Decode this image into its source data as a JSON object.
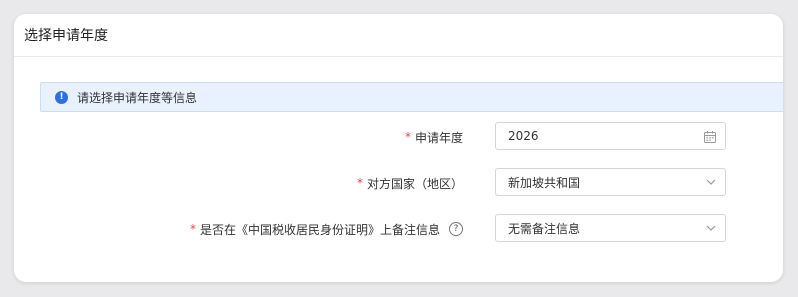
{
  "dialog": {
    "title": "选择申请年度"
  },
  "alert": {
    "icon": "info-icon",
    "text": "请选择申请年度等信息",
    "icon_color": "#2f6fde",
    "bg_color": "#e8f1fd"
  },
  "form": {
    "required_mark": "*",
    "fields": [
      {
        "label": "申请年度",
        "value": "2026",
        "type": "date",
        "icon": "calendar-icon"
      },
      {
        "label": "对方国家（地区）",
        "value": "新加坡共和国",
        "type": "select",
        "icon": "chevron-down-icon"
      },
      {
        "label": "是否在《中国税收居民身份证明》上备注信息",
        "value": "无需备注信息",
        "type": "select",
        "icon": "chevron-down-icon",
        "help_icon": "question-circle-icon",
        "help_glyph": "?"
      }
    ]
  },
  "colors": {
    "required": "#e5484d",
    "border": "#d5d5d5"
  }
}
